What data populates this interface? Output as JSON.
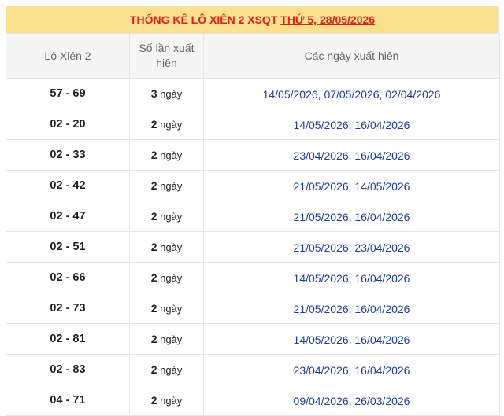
{
  "title": {
    "prefix": "THỐNG KÊ LÔ XIÊN 2 XSQT ",
    "link": "THỨ 5, 28/05/2026"
  },
  "headers": {
    "pair": "Lô Xiên 2",
    "count": "Số lần xuất hiện",
    "dates": "Các ngày xuất hiện"
  },
  "count_suffix": " ngày",
  "date_separator": ", ",
  "colors": {
    "title_bg": "#fbe08d",
    "title_text": "#e0201b",
    "date_link": "#1c3d9c",
    "header_bg": "#f5f5f5"
  },
  "rows": [
    {
      "pair": "57 - 69",
      "count": "3",
      "dates": [
        "14/05/2026",
        "07/05/2026",
        "02/04/2026"
      ]
    },
    {
      "pair": "02 - 20",
      "count": "2",
      "dates": [
        "14/05/2026",
        "16/04/2026"
      ]
    },
    {
      "pair": "02 - 33",
      "count": "2",
      "dates": [
        "23/04/2026",
        "16/04/2026"
      ]
    },
    {
      "pair": "02 - 42",
      "count": "2",
      "dates": [
        "21/05/2026",
        "14/05/2026"
      ]
    },
    {
      "pair": "02 - 47",
      "count": "2",
      "dates": [
        "21/05/2026",
        "16/04/2026"
      ]
    },
    {
      "pair": "02 - 51",
      "count": "2",
      "dates": [
        "21/05/2026",
        "23/04/2026"
      ]
    },
    {
      "pair": "02 - 66",
      "count": "2",
      "dates": [
        "14/05/2026",
        "16/04/2026"
      ]
    },
    {
      "pair": "02 - 73",
      "count": "2",
      "dates": [
        "21/05/2026",
        "16/04/2026"
      ]
    },
    {
      "pair": "02 - 81",
      "count": "2",
      "dates": [
        "14/05/2026",
        "16/04/2026"
      ]
    },
    {
      "pair": "02 - 83",
      "count": "2",
      "dates": [
        "23/04/2026",
        "16/04/2026"
      ]
    },
    {
      "pair": "04 - 71",
      "count": "2",
      "dates": [
        "09/04/2026",
        "26/03/2026"
      ]
    }
  ]
}
